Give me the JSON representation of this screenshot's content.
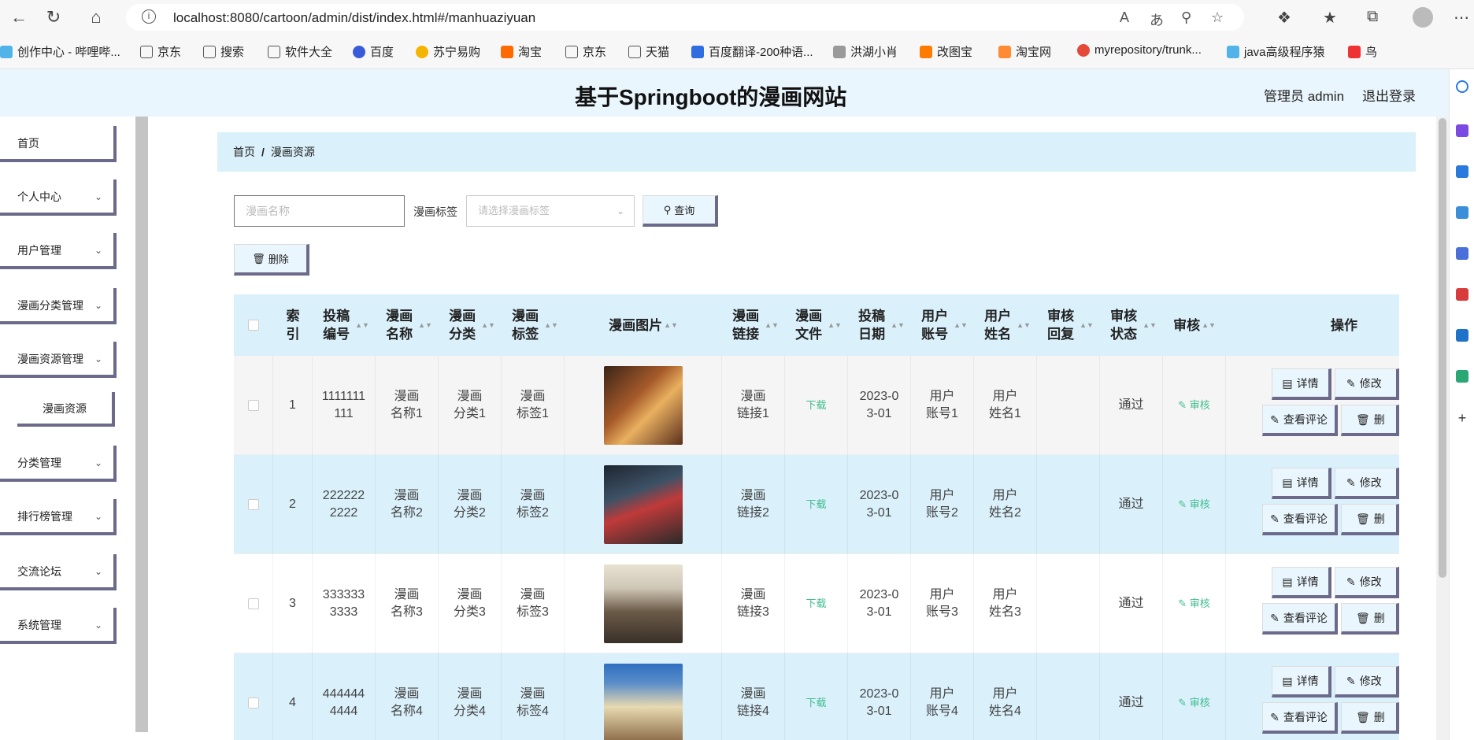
{
  "browser": {
    "url": "localhost:8080/cartoon/admin/dist/index.html#/manhuaziyuan",
    "bookmarks": [
      "创作中心 - 哔哩哔...",
      "京东",
      "搜索",
      "软件大全",
      "百度",
      "苏宁易购",
      "淘宝",
      "京东",
      "天猫",
      "百度翻译-200种语...",
      "洪湖小肖",
      "改图宝",
      "淘宝网",
      "myrepository/trunk...",
      "java高级程序猿",
      "鸟"
    ]
  },
  "header": {
    "title": "基于Springboot的漫画网站",
    "admin_label": "管理员 admin",
    "logout_label": "退出登录"
  },
  "sidebar": {
    "items": [
      {
        "label": "首页"
      },
      {
        "label": "个人中心"
      },
      {
        "label": "用户管理"
      },
      {
        "label": "漫画分类管理"
      },
      {
        "label": "漫画资源管理"
      },
      {
        "label": "漫画资源"
      },
      {
        "label": "分类管理"
      },
      {
        "label": "排行榜管理"
      },
      {
        "label": "交流论坛"
      },
      {
        "label": "系统管理"
      }
    ]
  },
  "breadcrumb": {
    "home": "首页",
    "sep": "/",
    "current": "漫画资源"
  },
  "search": {
    "name_placeholder": "漫画名称",
    "tag_label": "漫画标签",
    "tag_placeholder": "请选择漫画标签",
    "query_label": "查询",
    "delete_label": "删除"
  },
  "table": {
    "headers": [
      "索引",
      "投稿编号",
      "漫画名称",
      "漫画分类",
      "漫画标签",
      "漫画图片",
      "漫画链接",
      "漫画文件",
      "投稿日期",
      "用户账号",
      "用户姓名",
      "审核回复",
      "审核状态",
      "审核",
      "操作"
    ],
    "rows": [
      {
        "index": "1",
        "code": "1111111111",
        "name": "漫画名称1",
        "category": "漫画分类1",
        "tag": "漫画标签1",
        "link": "漫画链接1",
        "file": "下载",
        "date": "2023-03-01",
        "account": "用户账号1",
        "username": "用户姓名1",
        "reply": "",
        "status": "通过",
        "audit": "审核",
        "thumb_color": "#8a4a2a"
      },
      {
        "index": "2",
        "code": "2222222222",
        "name": "漫画名称2",
        "category": "漫画分类2",
        "tag": "漫画标签2",
        "link": "漫画链接2",
        "file": "下载",
        "date": "2023-03-01",
        "account": "用户账号2",
        "username": "用户姓名2",
        "reply": "",
        "status": "通过",
        "audit": "审核",
        "thumb_color": "#2e3a4a"
      },
      {
        "index": "3",
        "code": "3333333333",
        "name": "漫画名称3",
        "category": "漫画分类3",
        "tag": "漫画标签3",
        "link": "漫画链接3",
        "file": "下载",
        "date": "2023-03-01",
        "account": "用户账号3",
        "username": "用户姓名3",
        "reply": "",
        "status": "通过",
        "audit": "审核",
        "thumb_color": "#cfc7b6"
      },
      {
        "index": "4",
        "code": "4444444444",
        "name": "漫画名称4",
        "category": "漫画分类4",
        "tag": "漫画标签4",
        "link": "漫画链接4",
        "file": "下载",
        "date": "2023-03-01",
        "account": "用户账号4",
        "username": "用户姓名4",
        "reply": "",
        "status": "通过",
        "audit": "审核",
        "thumb_color": "#5b8ec9"
      }
    ],
    "ops": {
      "detail": "详情",
      "edit": "修改",
      "comments": "查看评论",
      "delete": "删"
    }
  },
  "colors": {
    "accent_bg": "#daf0fb",
    "header_bg": "#eaf6fd",
    "shadow": "#6b6a8a",
    "link": "#3fbd8e"
  }
}
